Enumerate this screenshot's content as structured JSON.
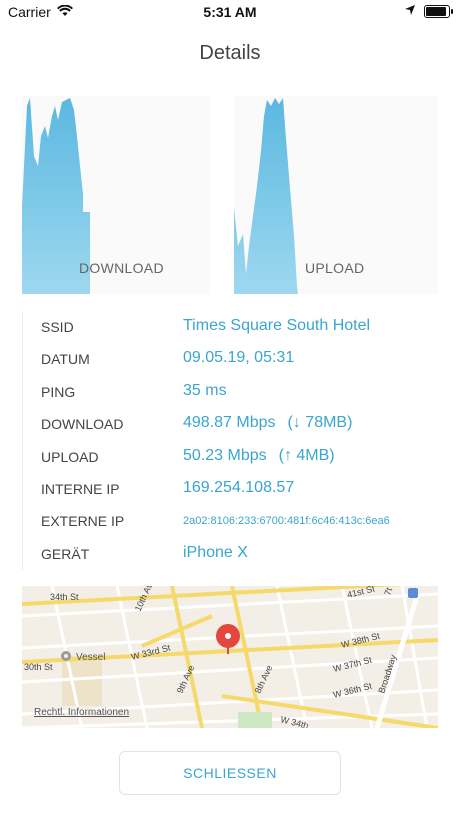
{
  "status_bar": {
    "carrier": "Carrier",
    "time": "5:31 AM"
  },
  "header": {
    "title": "Details"
  },
  "graphs": {
    "download_label": "DOWNLOAD",
    "upload_label": "UPLOAD"
  },
  "details": {
    "rows": [
      {
        "label": "SSID",
        "value": "Times Square South Hotel",
        "extra": ""
      },
      {
        "label": "DATUM",
        "value": "09.05.19, 05:31",
        "extra": ""
      },
      {
        "label": "PING",
        "value": "35 ms",
        "extra": ""
      },
      {
        "label": "DOWNLOAD",
        "value": "498.87 Mbps",
        "extra": "(↓ 78MB)"
      },
      {
        "label": "UPLOAD",
        "value": "50.23 Mbps",
        "extra": "(↑ 4MB)"
      },
      {
        "label": "INTERNE IP",
        "value": "169.254.108.57",
        "extra": ""
      },
      {
        "label": "EXTERNE IP",
        "value": "2a02:8106:233:6700:481f:6c46:413c:6ea6",
        "extra": ""
      },
      {
        "label": "GERÄT",
        "value": "iPhone X",
        "extra": ""
      }
    ]
  },
  "map": {
    "legal_link": "Rechtl. Informationen",
    "streets": [
      "34th St",
      "10th Av",
      "W 33rd St",
      "9th Ave",
      "8th Ave",
      "W 34th",
      "W 38th St",
      "W 37th St",
      "W 36th St",
      "Broadway",
      "41st St",
      "30th St",
      "7t"
    ],
    "poi": "Vessel"
  },
  "footer": {
    "close_label": "SCHLIESSEN"
  },
  "colors": {
    "accent": "#3aa5cf",
    "graph_fill": "#7fcbe8"
  }
}
